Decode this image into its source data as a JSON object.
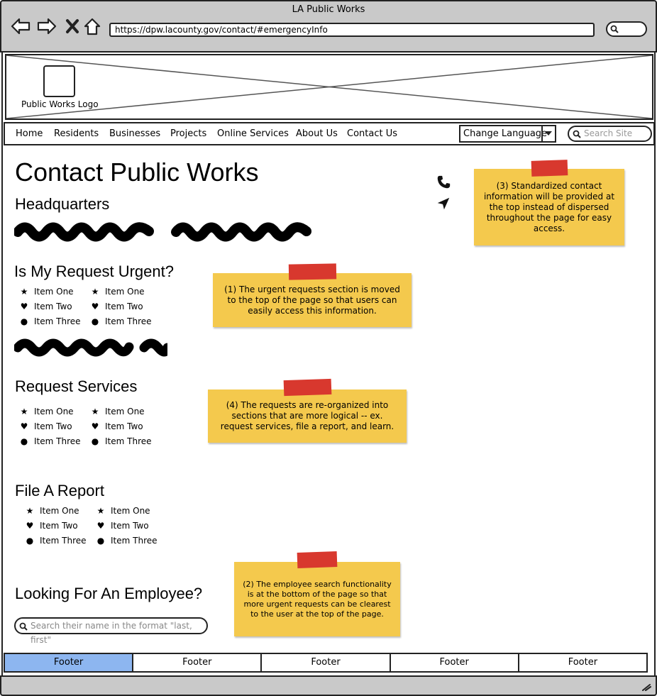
{
  "window": {
    "title": "LA Public Works",
    "url": "https://dpw.lacounty.gov/contact/#emergencyInfo"
  },
  "header": {
    "logo_label": "Public Works Logo"
  },
  "nav": {
    "items": [
      "Home",
      "Residents",
      "Businesses",
      "Projects",
      "Online Services",
      "About Us",
      "Contact Us"
    ],
    "language": "Change Language",
    "search_placeholder": "Search Site"
  },
  "page": {
    "title": "Contact Public Works",
    "headquarters": "Headquarters",
    "urgent": {
      "title": "Is My Request Urgent?",
      "col1": [
        "Item One",
        "Item Two",
        "Item Three"
      ],
      "col2": [
        "Item One",
        "Item Two",
        "Item Three"
      ]
    },
    "request_services": {
      "title": "Request Services",
      "col1": [
        "Item One",
        "Item Two",
        "Item Three"
      ],
      "col2": [
        "Item One",
        "Item Two",
        "Item Three"
      ]
    },
    "file_report": {
      "title": "File A Report",
      "col1": [
        "Item One",
        "Item Two",
        "Item Three"
      ],
      "col2": [
        "Item One",
        "Item Two",
        "Item Three"
      ]
    },
    "employee": {
      "title": "Looking For An Employee?",
      "search_placeholder": "Search their name in the format \"last, first\""
    }
  },
  "notes": {
    "note3": "(3) Standardized contact information will be provided at the top instead of dispersed throughout the page for easy access.",
    "note1": "(1) The urgent requests section is moved to the top of the page so that users can easily access this information.",
    "note4": "(4) The requests are re-organized into sections that are more logical -- ex. request services, file a report, and learn.",
    "note2": "(2) The employee search functionality is at the bottom of the page so that more urgent requests can be clearest to the user at the top of the page."
  },
  "footer": {
    "items": [
      "Footer",
      "Footer",
      "Footer",
      "Footer",
      "Footer"
    ]
  },
  "colors": {
    "sticky": "#f4c94d",
    "tape": "#d8382e",
    "footer_active": "#8db6f0",
    "chrome": "#c9c9c9"
  }
}
